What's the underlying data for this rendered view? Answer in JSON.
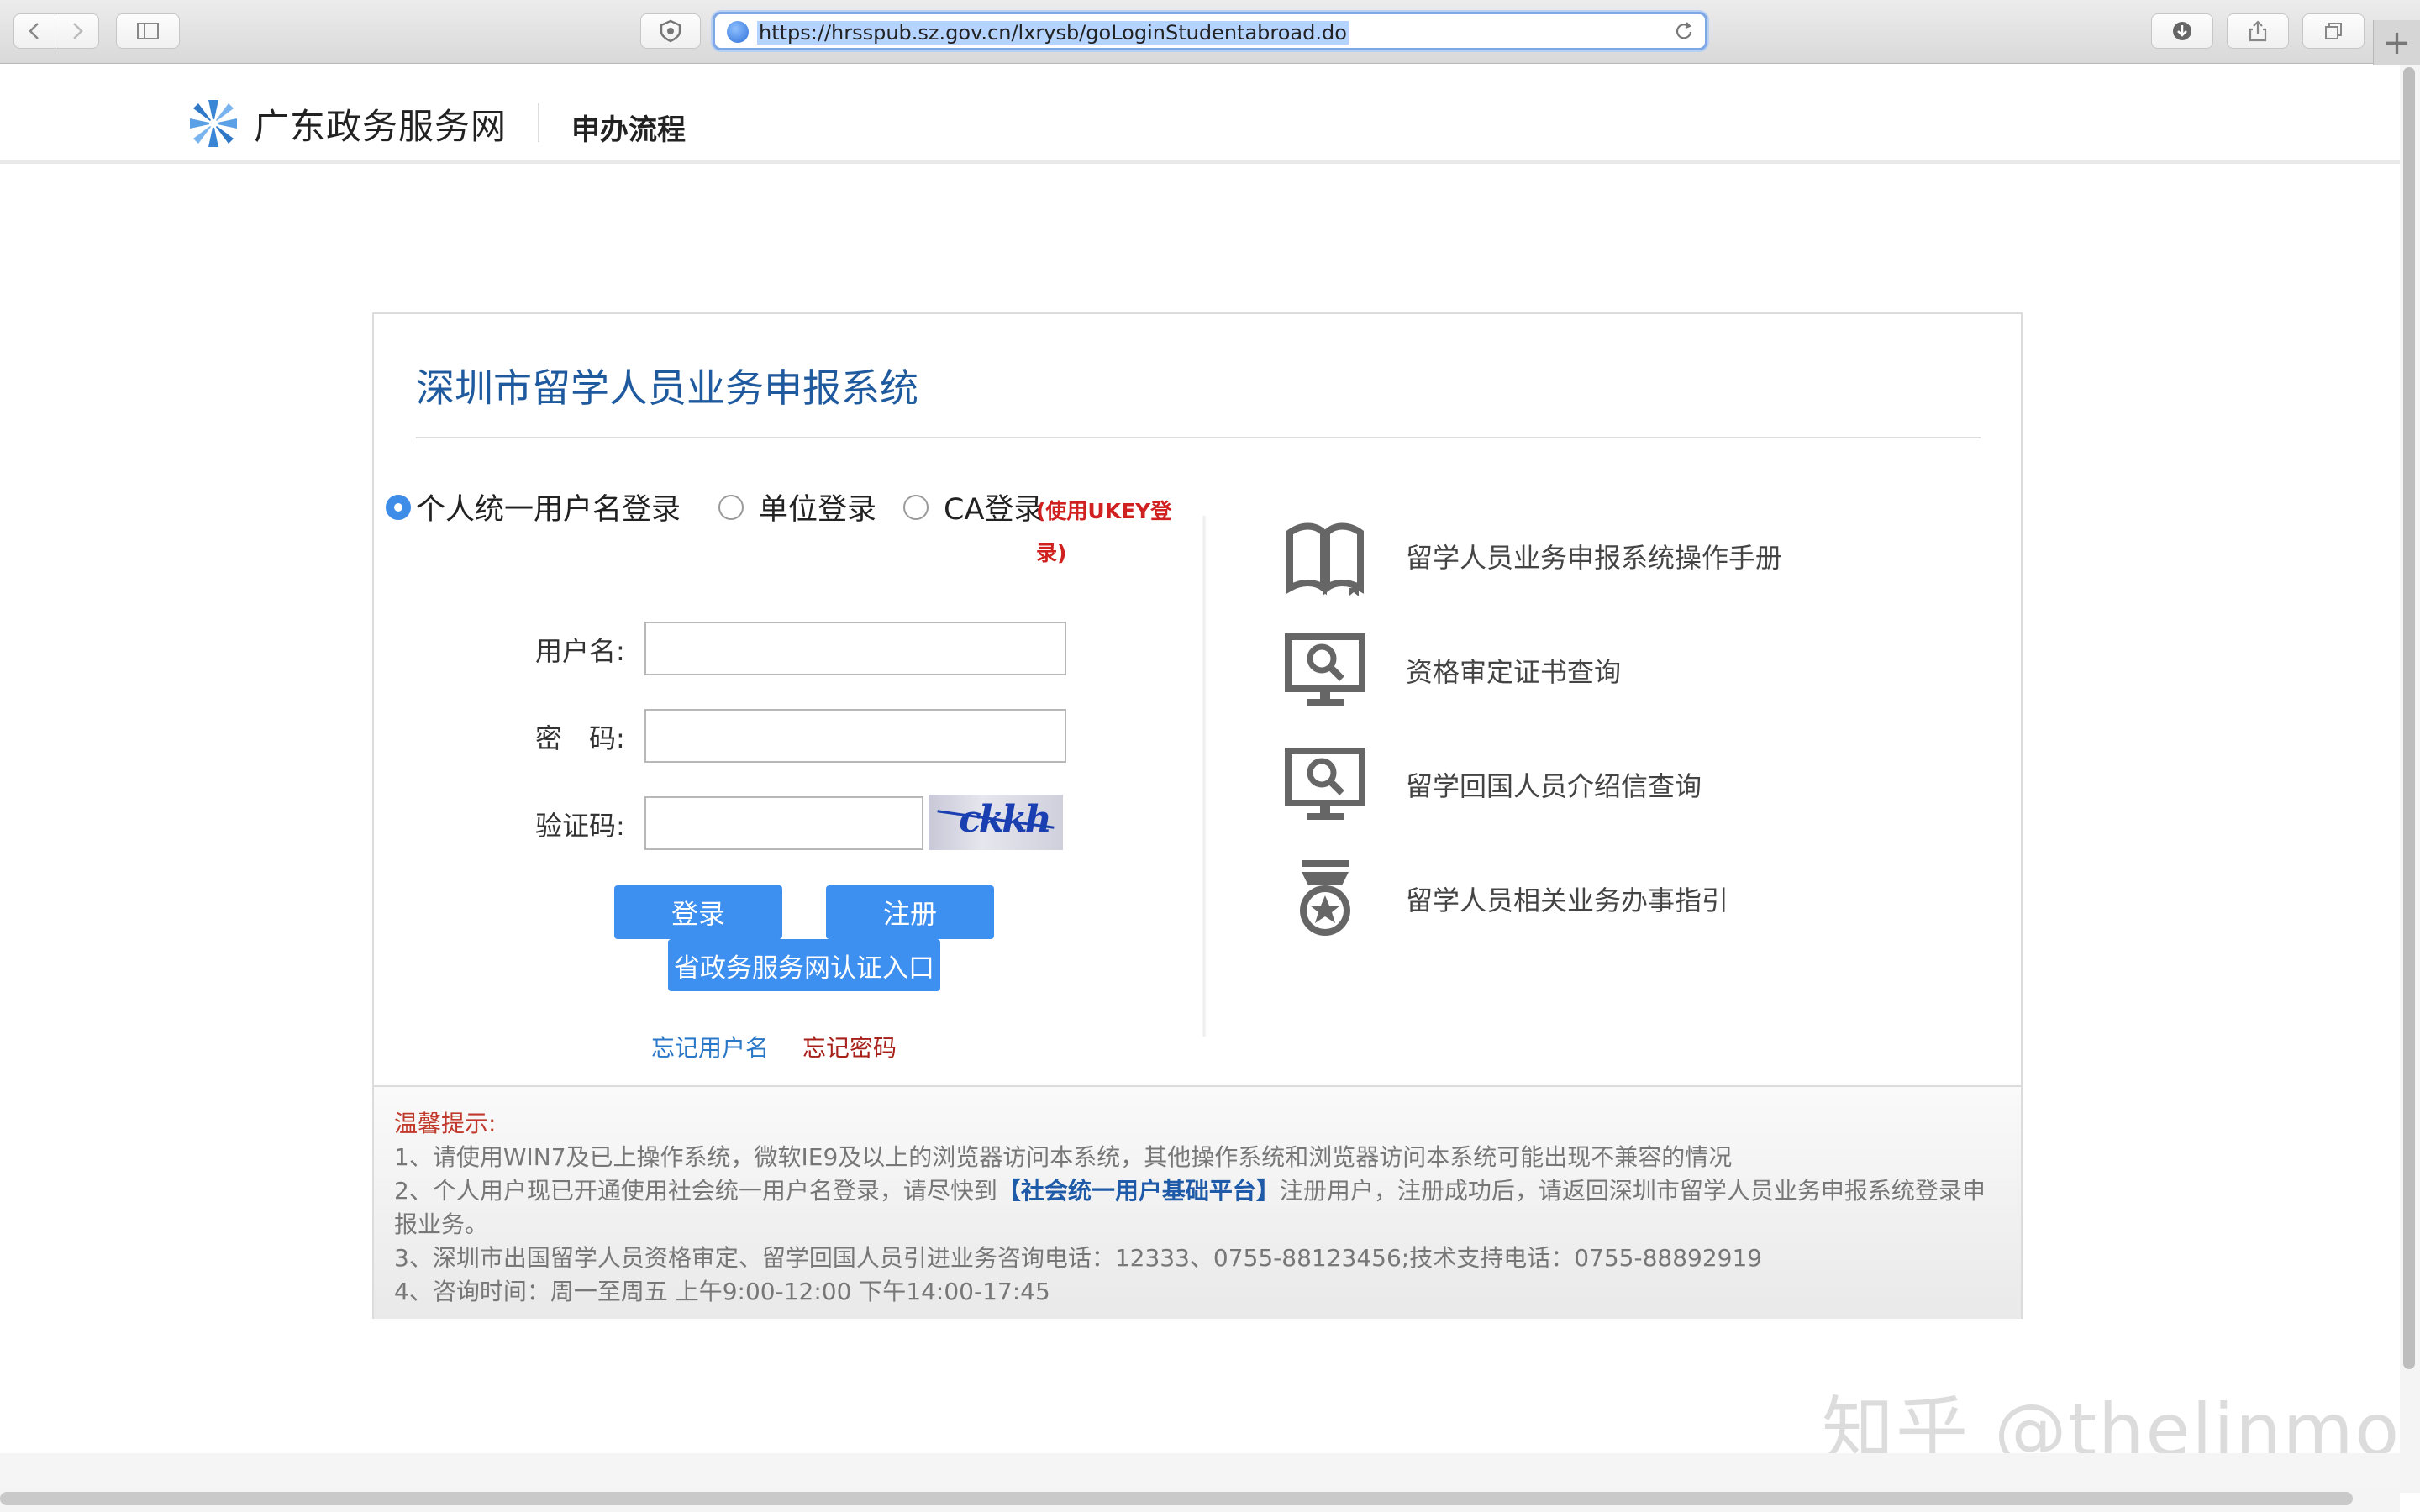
{
  "browser": {
    "url": "https://hrsspub.sz.gov.cn/lxrysb/goLoginStudentabroad.do",
    "new_tab_label": "+"
  },
  "header": {
    "logo_text": "广东政务服务网",
    "nav_label": "申办流程"
  },
  "panel": {
    "title": "深圳市留学人员业务申报系统",
    "login_modes": [
      {
        "label": "个人统一用户名登录",
        "selected": true
      },
      {
        "label": "单位登录",
        "selected": false
      },
      {
        "label": "CA登录",
        "selected": false
      }
    ],
    "ukey_note": "(使用UKEY登录)",
    "form": {
      "username_label": "用户名:",
      "password_label": "密　码:",
      "captcha_label": "验证码:",
      "captcha_text": "ckkh"
    },
    "buttons": {
      "login": "登录",
      "register": "注册",
      "province_auth": "省政务服务网认证入口"
    },
    "links": {
      "forgot_username": "忘记用户名",
      "forgot_password": "忘记密码"
    },
    "services": [
      {
        "label": "留学人员业务申报系统操作手册",
        "icon": "book-icon"
      },
      {
        "label": "资格审定证书查询",
        "icon": "monitor-search-icon"
      },
      {
        "label": "留学回国人员介绍信查询",
        "icon": "monitor-search-icon"
      },
      {
        "label": "留学人员相关业务办事指引",
        "icon": "medal-icon"
      }
    ],
    "notice": {
      "title": "温馨提示:",
      "line1": "1、请使用WIN7及已上操作系统，微软IE9及以上的浏览器访问本系统，其他操作系统和浏览器访问本系统可能出现不兼容的情况",
      "line2_pre": "2、个人用户现已开通使用社会统一用户名登录，请尽快到",
      "line2_link": "【社会统一用户基础平台】",
      "line2_post": "注册用户，注册成功后，请返回深圳市留学人员业务申报系统登录申报业务。",
      "line3": "3、深圳市出国留学人员资格审定、留学回国人员引进业务咨询电话：12333、0755-88123456;技术支持电话：0755-88892919",
      "line4": "4、咨询时间：周一至周五 上午9:00-12:00 下午14:00-17:45"
    }
  },
  "watermark": "知乎 @thelinmo",
  "colors": {
    "accent": "#3d8ff0",
    "title": "#1f5a9e",
    "alert": "#d02020"
  }
}
